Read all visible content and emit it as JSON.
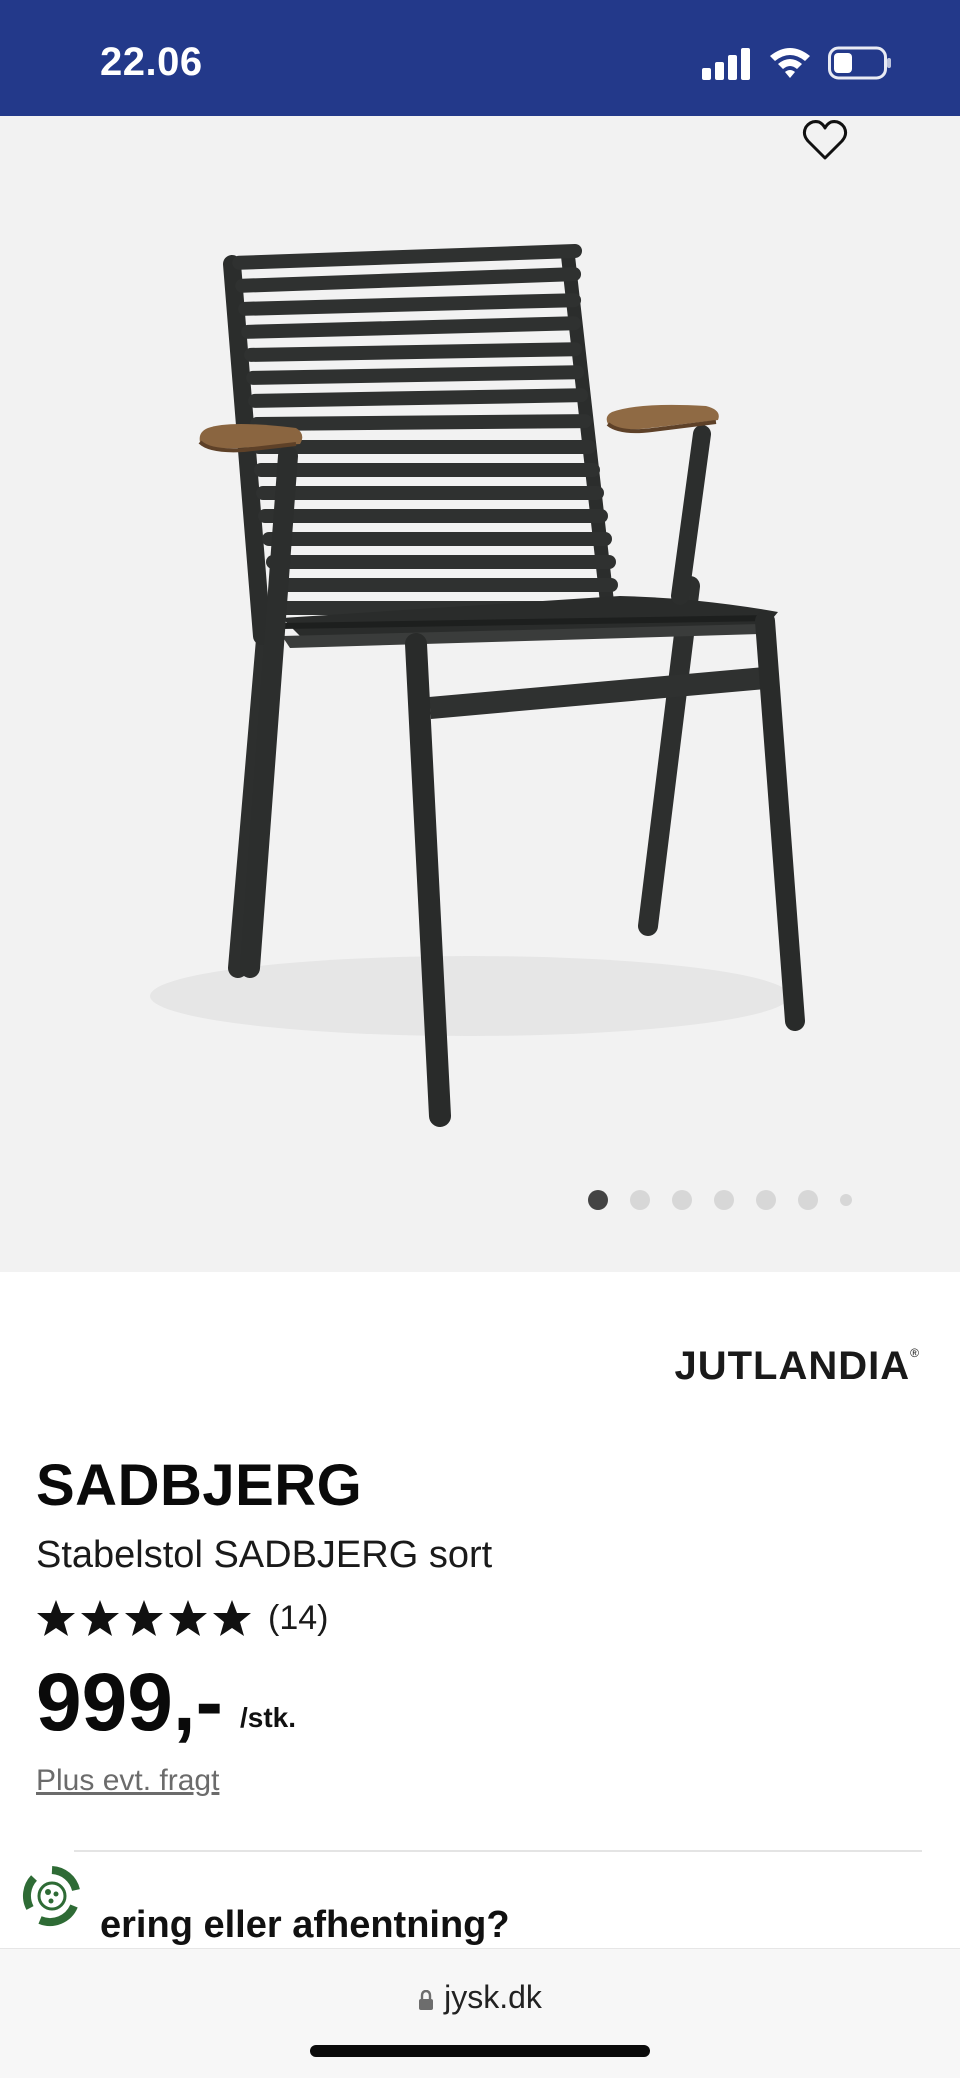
{
  "status_bar": {
    "time": "22.06"
  },
  "gallery": {
    "image_alt": "Stabelstol SADBJERG sort",
    "slide_count": 7,
    "active_slide": 1
  },
  "product": {
    "brand": "JUTLANDIA",
    "brand_mark": "®",
    "name": "SADBJERG",
    "subtitle": "Stabelstol SADBJERG sort",
    "rating": 5,
    "rating_count": "(14)",
    "price": "999,-",
    "unit": "/stk.",
    "shipping_note": "Plus evt. fragt"
  },
  "delivery": {
    "heading": "ering eller afhentning?"
  },
  "browser": {
    "url": "jysk.dk"
  },
  "colors": {
    "header": "#23398a",
    "gallery_bg": "#f2f2f2",
    "eco_green": "#2e6b35"
  },
  "icons": [
    "signal-icon",
    "wifi-icon",
    "battery-icon",
    "heart-icon",
    "star-icon",
    "eco-badge-icon",
    "lock-icon"
  ]
}
